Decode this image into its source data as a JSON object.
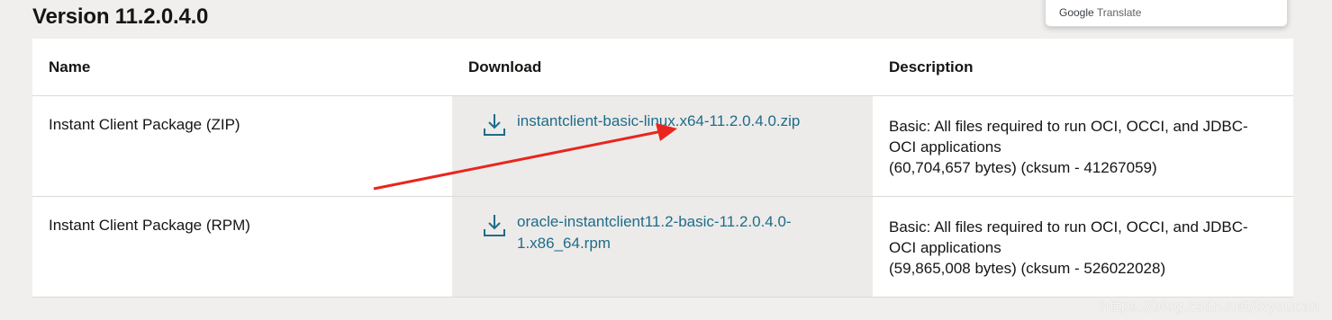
{
  "version_title": "Version 11.2.0.4.0",
  "translate_popup": {
    "brand": "Google",
    "label": "Translate"
  },
  "table": {
    "headers": [
      "Name",
      "Download",
      "Description"
    ],
    "rows": [
      {
        "name": "Instant Client Package (ZIP)",
        "download": "instantclient-basic-linux.x64-11.2.0.4.0.zip",
        "description_line1": "Basic: All files required to run OCI, OCCI, and JDBC-",
        "description_line2": "OCI applications",
        "description_line3": "(60,704,657 bytes) (cksum - 41267059)"
      },
      {
        "name": "Instant Client Package (RPM)",
        "download_line1": "oracle-instantclient11.2-basic-11.2.0.4.0-",
        "download_line2": "1.x86_64.rpm",
        "description_line1": "Basic: All files required to run OCI, OCCI, and JDBC-",
        "description_line2": "OCI applications",
        "description_line3": "(59,865,008 bytes) (cksum - 526022028)"
      }
    ]
  },
  "watermark": "https://blog.csdn.net/lxyoucan",
  "colors": {
    "link": "#1f6c8a",
    "arrow": "#e8261d",
    "download_bg": "#ecebe9"
  }
}
